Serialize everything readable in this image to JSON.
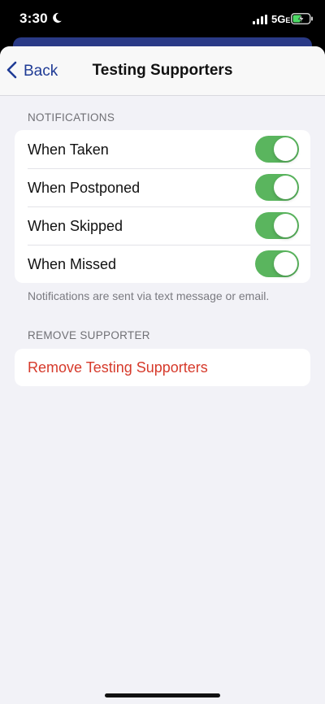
{
  "status": {
    "time": "3:30",
    "network": "5G",
    "network_suffix": "E",
    "icons": [
      "moon-icon",
      "signal-icon",
      "battery-charging-icon"
    ]
  },
  "nav": {
    "back_label": "Back",
    "title": "Testing Supporters"
  },
  "notifications": {
    "header": "NOTIFICATIONS",
    "items": [
      {
        "label": "When Taken",
        "on": true
      },
      {
        "label": "When Postponed",
        "on": true
      },
      {
        "label": "When Skipped",
        "on": true
      },
      {
        "label": "When Missed",
        "on": true
      }
    ],
    "footer": "Notifications are sent via text message or email."
  },
  "remove": {
    "header": "REMOVE SUPPORTER",
    "action_label": "Remove Testing Supporters"
  },
  "colors": {
    "toggle_on": "#5ab55e",
    "accent": "#1f3b95",
    "destructive": "#d63a2b"
  }
}
